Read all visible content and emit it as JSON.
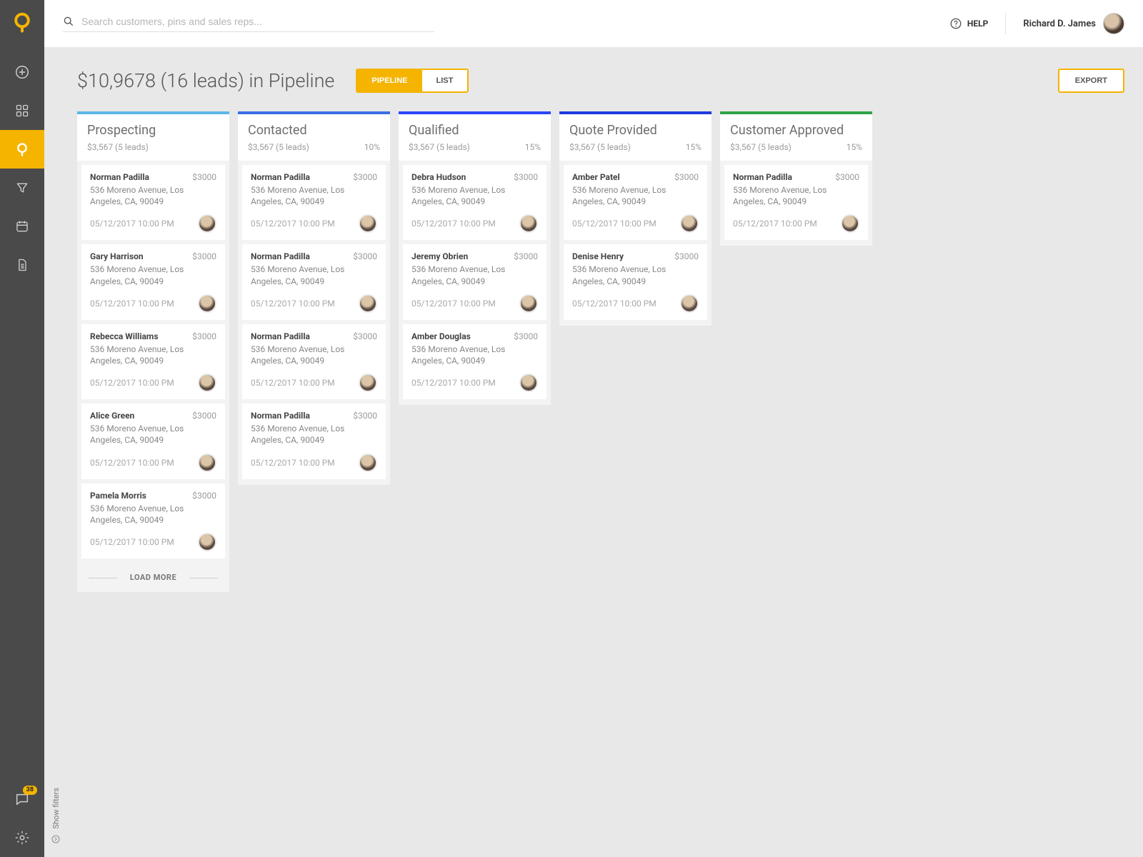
{
  "search": {
    "placeholder": "Search customers, pins and sales reps..."
  },
  "topbar": {
    "help_label": "HELP",
    "user_name": "Richard D. James"
  },
  "sidebar": {
    "chat_badge": "38",
    "filters_label": "Show filters"
  },
  "page": {
    "title": "$10,9678 (16 leads) in Pipeline",
    "view_pipeline": "PIPELINE",
    "view_list": "LIST",
    "export": "EXPORT"
  },
  "colors": {
    "prospecting": "#5bb7e6",
    "contacted": "#3b6fe6",
    "qualified": "#2a47ff",
    "quote": "#1e3ae0",
    "approved": "#2fa348"
  },
  "columns": [
    {
      "title": "Prospecting",
      "summary": "$3,567 (5 leads)",
      "pct": "",
      "load_more": "LOAD MORE",
      "cards": [
        {
          "name": "Norman Padilla",
          "amount": "$3000",
          "address": "536 Moreno Avenue, Los Angeles, CA, 90049",
          "date": "05/12/2017",
          "time": "10:00 PM"
        },
        {
          "name": "Gary Harrison",
          "amount": "$3000",
          "address": "536 Moreno Avenue, Los Angeles, CA, 90049",
          "date": "05/12/2017",
          "time": "10:00 PM"
        },
        {
          "name": "Rebecca Williams",
          "amount": "$3000",
          "address": "536 Moreno Avenue, Los Angeles, CA, 90049",
          "date": "05/12/2017",
          "time": "10:00 PM"
        },
        {
          "name": "Alice Green",
          "amount": "$3000",
          "address": "536 Moreno Avenue, Los Angeles, CA, 90049",
          "date": "05/12/2017",
          "time": "10:00 PM"
        },
        {
          "name": "Pamela Morris",
          "amount": "$3000",
          "address": "536 Moreno Avenue, Los Angeles, CA, 90049",
          "date": "05/12/2017",
          "time": "10:00 PM"
        }
      ]
    },
    {
      "title": "Contacted",
      "summary": "$3,567 (5 leads)",
      "pct": "10%",
      "cards": [
        {
          "name": "Norman Padilla",
          "amount": "$3000",
          "address": "536 Moreno Avenue, Los Angeles, CA, 90049",
          "date": "05/12/2017",
          "time": "10:00 PM"
        },
        {
          "name": "Norman Padilla",
          "amount": "$3000",
          "address": "536 Moreno Avenue, Los Angeles, CA, 90049",
          "date": "05/12/2017",
          "time": "10:00 PM"
        },
        {
          "name": "Norman Padilla",
          "amount": "$3000",
          "address": "536 Moreno Avenue, Los Angeles, CA, 90049",
          "date": "05/12/2017",
          "time": "10:00 PM"
        },
        {
          "name": "Norman Padilla",
          "amount": "$3000",
          "address": "536 Moreno Avenue, Los Angeles, CA, 90049",
          "date": "05/12/2017",
          "time": "10:00 PM"
        }
      ]
    },
    {
      "title": "Qualified",
      "summary": "$3,567 (5 leads)",
      "pct": "15%",
      "cards": [
        {
          "name": "Debra Hudson",
          "amount": "$3000",
          "address": "536 Moreno Avenue, Los Angeles, CA, 90049",
          "date": "05/12/2017",
          "time": "10:00 PM"
        },
        {
          "name": "Jeremy Obrien",
          "amount": "$3000",
          "address": "536 Moreno Avenue, Los Angeles, CA, 90049",
          "date": "05/12/2017",
          "time": "10:00 PM"
        },
        {
          "name": "Amber Douglas",
          "amount": "$3000",
          "address": "536 Moreno Avenue, Los Angeles, CA, 90049",
          "date": "05/12/2017",
          "time": "10:00 PM"
        }
      ]
    },
    {
      "title": "Quote Provided",
      "summary": "$3,567 (5 leads)",
      "pct": "15%",
      "cards": [
        {
          "name": "Amber Patel",
          "amount": "$3000",
          "address": "536 Moreno Avenue, Los Angeles, CA, 90049",
          "date": "05/12/2017",
          "time": "10:00 PM"
        },
        {
          "name": "Denise Henry",
          "amount": "$3000",
          "address": "536 Moreno Avenue, Los Angeles, CA, 90049",
          "date": "05/12/2017",
          "time": "10:00 PM"
        }
      ]
    },
    {
      "title": "Customer Approved",
      "summary": "$3,567 (5 leads)",
      "pct": "15%",
      "cards": [
        {
          "name": "Norman Padilla",
          "amount": "$3000",
          "address": "536 Moreno Avenue, Los Angeles, CA, 90049",
          "date": "05/12/2017",
          "time": "10:00 PM"
        }
      ]
    }
  ]
}
